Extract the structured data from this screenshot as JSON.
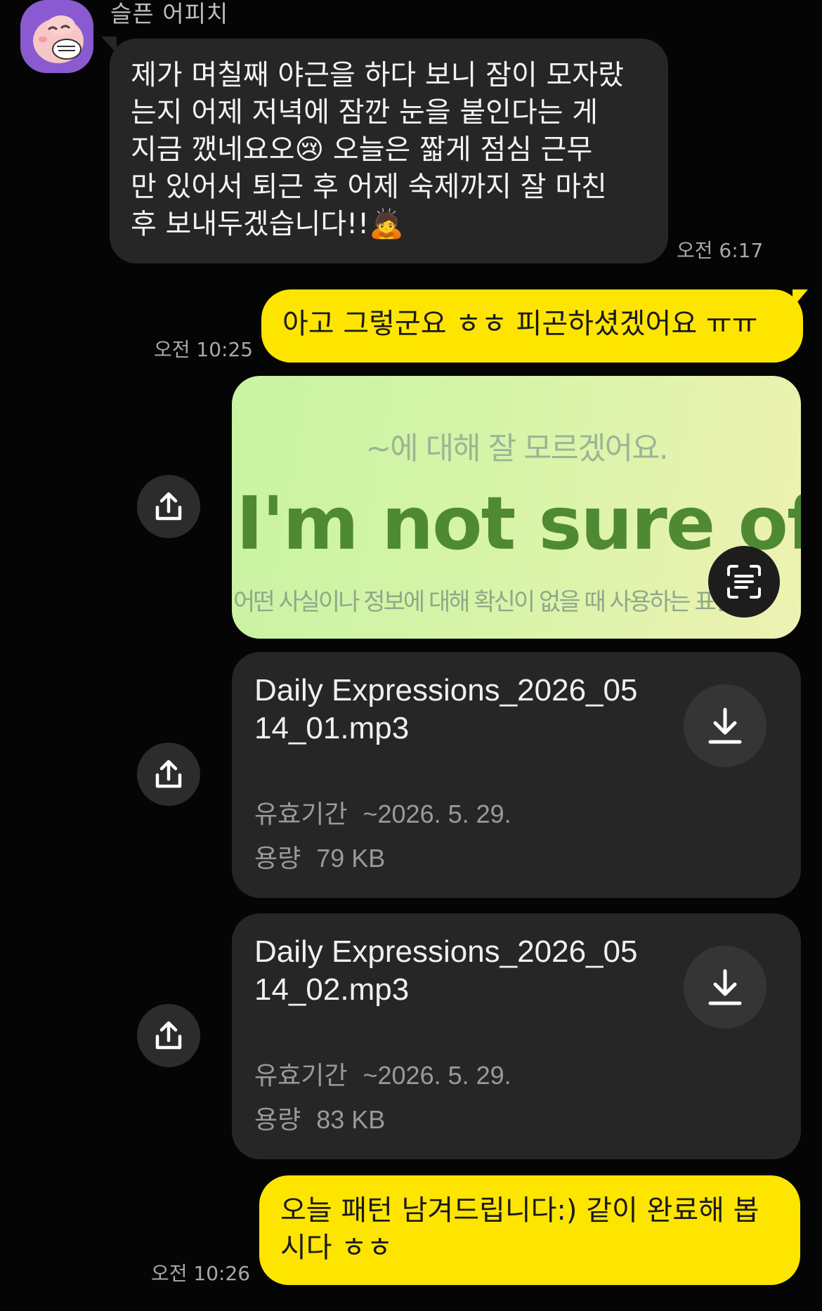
{
  "incoming": {
    "sender": "슬픈 어피치",
    "text": "제가 며칠째 야근을 하다 보니 잠이 모자랐\n는지 어제 저녁에 잠깐 눈을 붙인다는 게\n지금 깼네요오😢 오늘은 짧게 점심 근무\n만 있어서 퇴근 후 어제 숙제까지 잘 마친\n후 보내두겠습니다!!🙇",
    "time": "오전 6:17"
  },
  "reply1": {
    "text": "아고 그렇군요 ㅎㅎ 피곤하셨겠어요 ㅠㅠ",
    "time": "오전 10:25"
  },
  "image_message": {
    "ko_top": "~에 대해 잘 모르겠어요.",
    "en": "I'm not sure of ~",
    "ko_bottom": "어떤 사실이나 정보에 대해 확신이 없을 때 사용하는 표현"
  },
  "files": [
    {
      "name": "Daily Expressions_2026_0514_01.mp3",
      "validity_label": "유효기간",
      "validity_value": "~2026. 5. 29.",
      "size_label": "용량",
      "size_value": "79 KB"
    },
    {
      "name": "Daily Expressions_2026_0514_02.mp3",
      "validity_label": "유효기간",
      "validity_value": "~2026. 5. 29.",
      "size_label": "용량",
      "size_value": "83 KB"
    }
  ],
  "reply2": {
    "text": "오늘 패턴 남겨드립니다:) 같이 완료해 봅시다 ㅎㅎ",
    "time": "오전 10:26"
  },
  "icons": {
    "avatar": "apeach-crying-avatar",
    "share": "share-icon",
    "download": "download-icon",
    "scan": "text-scan-icon"
  },
  "colors": {
    "background": "#050505",
    "incoming_bubble": "#262626",
    "outgoing_bubble": "#fee500",
    "image_bg": "#d6f4a8",
    "image_en_text": "#4f8a33"
  }
}
